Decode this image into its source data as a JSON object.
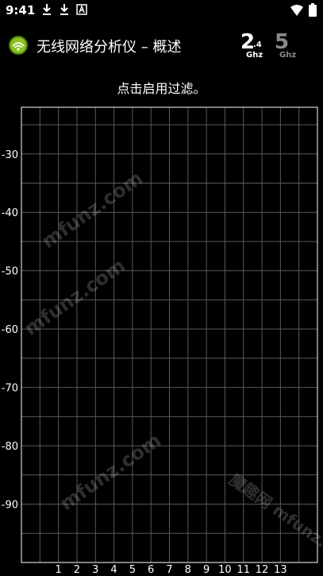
{
  "status_bar": {
    "time": "9:41",
    "icons": [
      "download-icon",
      "download-icon",
      "accessibility-icon",
      "wifi-icon",
      "battery-icon"
    ]
  },
  "toolbar": {
    "title": "无线网络分析仪 – 概述",
    "band_24": {
      "main": "2",
      "sub": ".4",
      "unit": "Ghz",
      "color": "#ffffff"
    },
    "band_5": {
      "main": "5",
      "unit": "Ghz",
      "color": "#8a8a8a"
    }
  },
  "filter_hint": "点击启用过滤。",
  "chart_data": {
    "type": "line",
    "title": "",
    "xlabel": "",
    "ylabel": "",
    "x_ticks": [
      "1",
      "2",
      "3",
      "4",
      "5",
      "6",
      "7",
      "8",
      "9",
      "10",
      "11",
      "12",
      "13"
    ],
    "y_ticks": [
      "-30",
      "-40",
      "-50",
      "-60",
      "-70",
      "-80",
      "-90"
    ],
    "y_tick_values": [
      -30,
      -40,
      -50,
      -60,
      -70,
      -80,
      -90
    ],
    "xlim": [
      -1,
      15
    ],
    "ylim": [
      -100,
      -22
    ],
    "grid": true,
    "series": []
  },
  "watermarks": [
    "mfunz.com",
    "mfunz.com",
    "mfunz.com",
    "魔趣网 mfunz.com"
  ]
}
